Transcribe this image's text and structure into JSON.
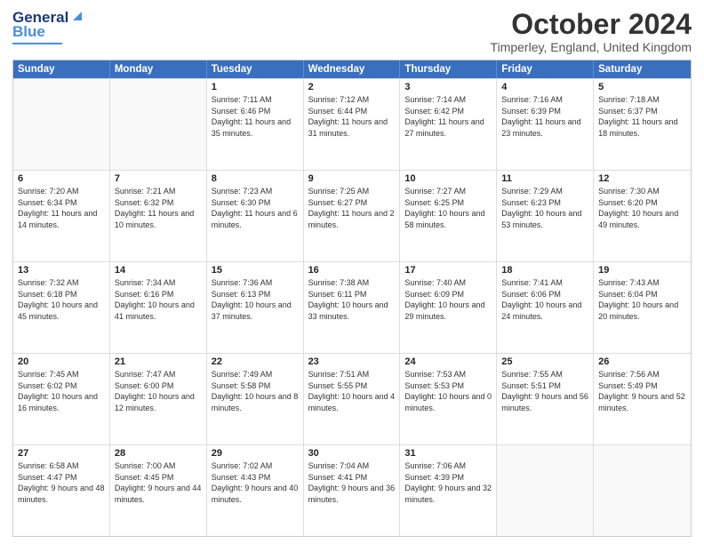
{
  "header": {
    "logo_general": "General",
    "logo_blue": "Blue",
    "month_title": "October 2024",
    "location": "Timperley, England, United Kingdom"
  },
  "days_of_week": [
    "Sunday",
    "Monday",
    "Tuesday",
    "Wednesday",
    "Thursday",
    "Friday",
    "Saturday"
  ],
  "weeks": [
    [
      {
        "day": "",
        "empty": true
      },
      {
        "day": "",
        "empty": true
      },
      {
        "day": "1",
        "sunrise": "7:11 AM",
        "sunset": "6:46 PM",
        "daylight": "11 hours and 35 minutes."
      },
      {
        "day": "2",
        "sunrise": "7:12 AM",
        "sunset": "6:44 PM",
        "daylight": "11 hours and 31 minutes."
      },
      {
        "day": "3",
        "sunrise": "7:14 AM",
        "sunset": "6:42 PM",
        "daylight": "11 hours and 27 minutes."
      },
      {
        "day": "4",
        "sunrise": "7:16 AM",
        "sunset": "6:39 PM",
        "daylight": "11 hours and 23 minutes."
      },
      {
        "day": "5",
        "sunrise": "7:18 AM",
        "sunset": "6:37 PM",
        "daylight": "11 hours and 18 minutes."
      }
    ],
    [
      {
        "day": "6",
        "sunrise": "7:20 AM",
        "sunset": "6:34 PM",
        "daylight": "11 hours and 14 minutes."
      },
      {
        "day": "7",
        "sunrise": "7:21 AM",
        "sunset": "6:32 PM",
        "daylight": "11 hours and 10 minutes."
      },
      {
        "day": "8",
        "sunrise": "7:23 AM",
        "sunset": "6:30 PM",
        "daylight": "11 hours and 6 minutes."
      },
      {
        "day": "9",
        "sunrise": "7:25 AM",
        "sunset": "6:27 PM",
        "daylight": "11 hours and 2 minutes."
      },
      {
        "day": "10",
        "sunrise": "7:27 AM",
        "sunset": "6:25 PM",
        "daylight": "10 hours and 58 minutes."
      },
      {
        "day": "11",
        "sunrise": "7:29 AM",
        "sunset": "6:23 PM",
        "daylight": "10 hours and 53 minutes."
      },
      {
        "day": "12",
        "sunrise": "7:30 AM",
        "sunset": "6:20 PM",
        "daylight": "10 hours and 49 minutes."
      }
    ],
    [
      {
        "day": "13",
        "sunrise": "7:32 AM",
        "sunset": "6:18 PM",
        "daylight": "10 hours and 45 minutes."
      },
      {
        "day": "14",
        "sunrise": "7:34 AM",
        "sunset": "6:16 PM",
        "daylight": "10 hours and 41 minutes."
      },
      {
        "day": "15",
        "sunrise": "7:36 AM",
        "sunset": "6:13 PM",
        "daylight": "10 hours and 37 minutes."
      },
      {
        "day": "16",
        "sunrise": "7:38 AM",
        "sunset": "6:11 PM",
        "daylight": "10 hours and 33 minutes."
      },
      {
        "day": "17",
        "sunrise": "7:40 AM",
        "sunset": "6:09 PM",
        "daylight": "10 hours and 29 minutes."
      },
      {
        "day": "18",
        "sunrise": "7:41 AM",
        "sunset": "6:06 PM",
        "daylight": "10 hours and 24 minutes."
      },
      {
        "day": "19",
        "sunrise": "7:43 AM",
        "sunset": "6:04 PM",
        "daylight": "10 hours and 20 minutes."
      }
    ],
    [
      {
        "day": "20",
        "sunrise": "7:45 AM",
        "sunset": "6:02 PM",
        "daylight": "10 hours and 16 minutes."
      },
      {
        "day": "21",
        "sunrise": "7:47 AM",
        "sunset": "6:00 PM",
        "daylight": "10 hours and 12 minutes."
      },
      {
        "day": "22",
        "sunrise": "7:49 AM",
        "sunset": "5:58 PM",
        "daylight": "10 hours and 8 minutes."
      },
      {
        "day": "23",
        "sunrise": "7:51 AM",
        "sunset": "5:55 PM",
        "daylight": "10 hours and 4 minutes."
      },
      {
        "day": "24",
        "sunrise": "7:53 AM",
        "sunset": "5:53 PM",
        "daylight": "10 hours and 0 minutes."
      },
      {
        "day": "25",
        "sunrise": "7:55 AM",
        "sunset": "5:51 PM",
        "daylight": "9 hours and 56 minutes."
      },
      {
        "day": "26",
        "sunrise": "7:56 AM",
        "sunset": "5:49 PM",
        "daylight": "9 hours and 52 minutes."
      }
    ],
    [
      {
        "day": "27",
        "sunrise": "6:58 AM",
        "sunset": "4:47 PM",
        "daylight": "9 hours and 48 minutes."
      },
      {
        "day": "28",
        "sunrise": "7:00 AM",
        "sunset": "4:45 PM",
        "daylight": "9 hours and 44 minutes."
      },
      {
        "day": "29",
        "sunrise": "7:02 AM",
        "sunset": "4:43 PM",
        "daylight": "9 hours and 40 minutes."
      },
      {
        "day": "30",
        "sunrise": "7:04 AM",
        "sunset": "4:41 PM",
        "daylight": "9 hours and 36 minutes."
      },
      {
        "day": "31",
        "sunrise": "7:06 AM",
        "sunset": "4:39 PM",
        "daylight": "9 hours and 32 minutes."
      },
      {
        "day": "",
        "empty": true
      },
      {
        "day": "",
        "empty": true
      }
    ]
  ]
}
